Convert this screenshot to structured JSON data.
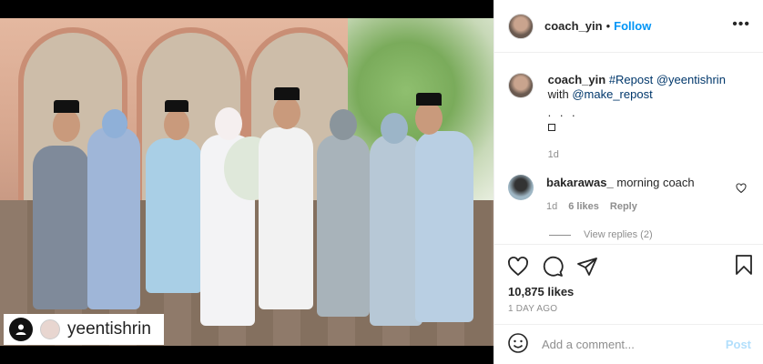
{
  "post_image": {
    "credit_name": "yeentishrin",
    "credit_icon": "repost-person-icon"
  },
  "header": {
    "username": "coach_yin",
    "separator": "•",
    "follow_label": "Follow",
    "more_icon": "more-dots-icon"
  },
  "caption": {
    "username": "coach_yin",
    "text_parts": [
      "#Repost",
      "@yeentishrin",
      "with",
      "@make_repost"
    ],
    "dots": ". . .",
    "time": "1d"
  },
  "comments": [
    {
      "username": "bakarawas_",
      "text": "morning coach",
      "time": "1d",
      "likes": "6 likes",
      "reply_label": "Reply",
      "view_replies": "View replies (2)"
    }
  ],
  "actions": {
    "likes": "10,875 likes",
    "ago": "1 DAY AGO"
  },
  "add_comment": {
    "placeholder": "Add a comment...",
    "post_label": "Post"
  },
  "colors": {
    "link_blue": "#0095f6",
    "hashtag": "#00376b",
    "post_disabled": "#b2dffc"
  }
}
